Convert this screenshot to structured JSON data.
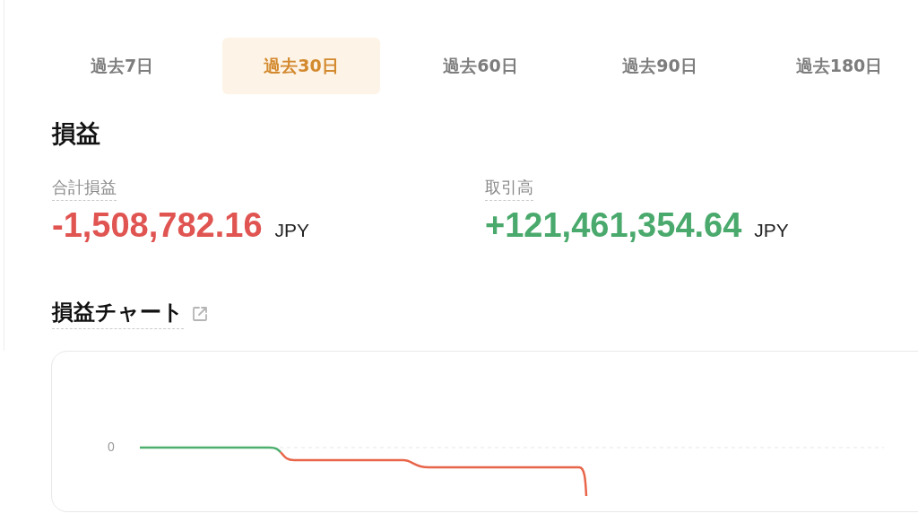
{
  "tabs": [
    {
      "label": "過去7日",
      "selected": false
    },
    {
      "label": "過去30日",
      "selected": true
    },
    {
      "label": "過去60日",
      "selected": false
    },
    {
      "label": "過去90日",
      "selected": false
    },
    {
      "label": "過去180日",
      "selected": false
    }
  ],
  "section_title": "損益",
  "metrics": [
    {
      "label": "合計損益",
      "value": "-1,508,782.16",
      "unit": "JPY",
      "kind": "negative"
    },
    {
      "label": "取引高",
      "value": "+121,461,354.64",
      "unit": "JPY",
      "kind": "positive"
    }
  ],
  "chart": {
    "title": "損益チャート",
    "y_tick": "0"
  }
}
